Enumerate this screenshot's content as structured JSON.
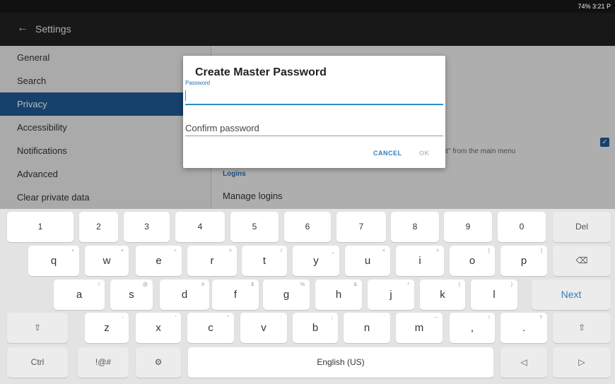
{
  "status": {
    "text": "74% 3:21 P"
  },
  "toolbar": {
    "back_icon": "arrow-left-icon",
    "title": "Settings"
  },
  "sidebar": {
    "items": [
      {
        "label": "General",
        "active": false
      },
      {
        "label": "Search",
        "active": false
      },
      {
        "label": "Privacy",
        "active": true
      },
      {
        "label": "Accessibility",
        "active": false
      },
      {
        "label": "Notifications",
        "active": false
      },
      {
        "label": "Advanced",
        "active": false
      },
      {
        "label": "Clear private data",
        "active": false
      }
    ]
  },
  "main": {
    "section_header": "Logins",
    "manage_logins": "Manage logins",
    "pref_text": "it\" from the main menu",
    "checkbox_checked": true
  },
  "dialog": {
    "title": "Create Master Password",
    "password_label": "Password",
    "password_value": "",
    "confirm_placeholder": "Confirm password",
    "cancel_label": "CANCEL",
    "ok_label": "OK"
  },
  "keyboard": {
    "row1": [
      "1",
      "2",
      "3",
      "4",
      "5",
      "6",
      "7",
      "8",
      "9",
      "0",
      "Del"
    ],
    "row2": [
      "q",
      "w",
      "e",
      "r",
      "t",
      "y",
      "u",
      "i",
      "o",
      "p",
      "⌫"
    ],
    "row2_hints": [
      "+",
      "×",
      "÷",
      "=",
      "/",
      "_",
      "<",
      ">",
      "[",
      "]",
      ""
    ],
    "row3": [
      "a",
      "s",
      "d",
      "f",
      "g",
      "h",
      "j",
      "k",
      "l",
      "Next"
    ],
    "row3_hints": [
      "!",
      "@",
      "#",
      "$",
      "%",
      "&",
      "*",
      "(",
      ")",
      ""
    ],
    "row4": [
      "⇧",
      "z",
      "x",
      "c",
      "v",
      "b",
      "n",
      "m",
      ",",
      ".",
      "⇧"
    ],
    "row4_hints": [
      "",
      "-",
      "'",
      "\"",
      ":",
      ";",
      "`",
      "~",
      "!",
      "?",
      ""
    ],
    "row5": [
      "Ctrl",
      "!@#",
      "⚙",
      "English (US)",
      "◁",
      "▷"
    ],
    "accent": "#2a7fc4",
    "selected_color": "#1e5a96"
  }
}
